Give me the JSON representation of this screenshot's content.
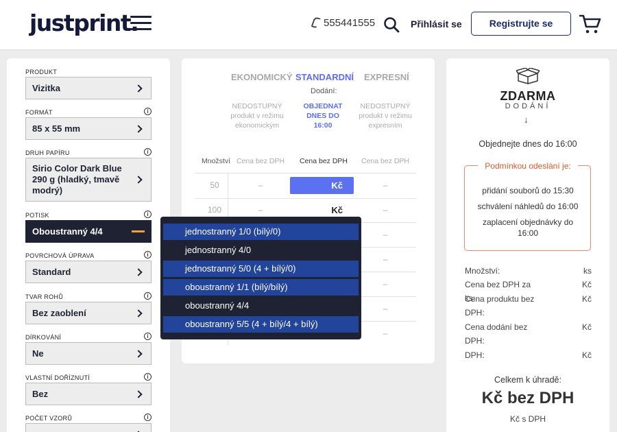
{
  "header": {
    "logo": "justprint.",
    "phone": "555441555",
    "login": "Přihlásit se",
    "register": "Registrujte se"
  },
  "options": [
    {
      "label": "PRODUKT",
      "value": "Vizitka",
      "info": false
    },
    {
      "label": "FORMÁT",
      "value": "85 x 55 mm",
      "info": true
    },
    {
      "label": "DRUH PAPÍRU",
      "value": "Sirio Color Dark Blue 290 g (hladký, tmavě modrý)",
      "info": true
    },
    {
      "label": "POTISK",
      "value": "Oboustranný 4/4",
      "info": true,
      "open": true
    },
    {
      "label": "POVRCHOVÁ ÚPRAVA",
      "value": "Standard",
      "info": true
    },
    {
      "label": "TVAR ROHŮ",
      "value": "Bez zaoblení",
      "info": true
    },
    {
      "label": "DÍRKOVÁNÍ",
      "value": "Ne",
      "info": true
    },
    {
      "label": "VLASTNÍ DOŘÍZNUTÍ",
      "value": "Bez",
      "info": true
    },
    {
      "label": "POČET VZORŮ",
      "value": "",
      "info": true
    }
  ],
  "pricing": {
    "tiers": [
      "EKONOMICKÝ",
      "STANDARDNÍ",
      "EXPRESNÍ"
    ],
    "delivery_label": "Dodání:",
    "tier_status": [
      "NEDOSTUPNÝ produkt v režimu ekonomickým",
      "OBJEDNAT DNES DO 16:00",
      "NEDOSTUPNÝ produkt v režimu expresním"
    ],
    "col_qty": "Množství",
    "col_price": "Cena bez DPH",
    "rows": [
      {
        "qty": "50",
        "eco": "–",
        "std": "Kč",
        "exp": "–"
      },
      {
        "qty": "100",
        "eco": "–",
        "std": "Kč",
        "exp": "–"
      },
      {
        "qty": "",
        "eco": "",
        "std": "",
        "exp": "–"
      },
      {
        "qty": "",
        "eco": "",
        "std": "",
        "exp": "–"
      },
      {
        "qty": "",
        "eco": "",
        "std": "",
        "exp": "–"
      },
      {
        "qty": "",
        "eco": "",
        "std": "",
        "exp": "–"
      },
      {
        "qty": "",
        "eco": "",
        "std": "",
        "exp": "–"
      }
    ]
  },
  "dropdown": [
    "jednostranný 1/0 (bílý/0)",
    "jednostranný 4/0",
    "jednostranný 5/0 (4 + bílý/0)",
    "oboustranný 1/1 (bílý/bílý)",
    "oboustranný 4/4",
    "oboustranný 5/5 (4 + bílý/4 + bílý)"
  ],
  "summary": {
    "free_title": "ZDARMA",
    "free_sub": "DODÁNÍ",
    "order_by": "Objednejte dnes do 16:00",
    "cond_title": "Podmínkou odeslání je:",
    "cond_lines": [
      "přidání souborů do 15:30",
      "schválení náhledů do 16:00",
      "zaplacení objednávky do 16:00"
    ],
    "rows": [
      {
        "label": "Množství:",
        "value": "ks"
      },
      {
        "label": "Cena bez DPH za ks:",
        "value": "Kč"
      },
      {
        "label": "Cena produktu bez DPH:",
        "value": "Kč"
      },
      {
        "label": "Cena dodání bez DPH:",
        "value": "Kč"
      },
      {
        "label": "DPH:",
        "value": "Kč"
      }
    ],
    "total_label": "Celkem k úhradě:",
    "total_big": "Kč bez DPH",
    "total_vat": "Kč s DPH"
  }
}
